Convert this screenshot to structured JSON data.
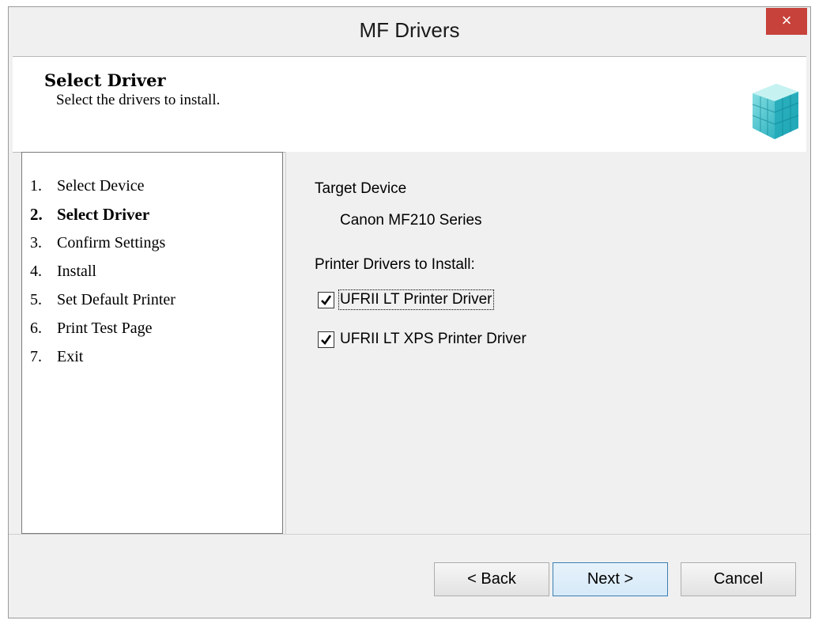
{
  "window": {
    "title": "MF Drivers",
    "close_label": "×"
  },
  "header": {
    "title": "Select Driver",
    "subtitle": "Select the drivers to install.",
    "icon": "cube-blocks-icon"
  },
  "steps": [
    {
      "num": "1.",
      "label": "Select Device"
    },
    {
      "num": "2.",
      "label": "Select Driver",
      "active": true
    },
    {
      "num": "3.",
      "label": "Confirm Settings"
    },
    {
      "num": "4.",
      "label": "Install"
    },
    {
      "num": "5.",
      "label": "Set Default Printer"
    },
    {
      "num": "6.",
      "label": "Print Test Page"
    },
    {
      "num": "7.",
      "label": "Exit"
    }
  ],
  "content": {
    "target_label": "Target Device",
    "target_value": "Canon MF210 Series",
    "drivers_label": "Printer Drivers to Install:",
    "drivers": [
      {
        "label": "UFRII LT Printer Driver",
        "checked": true
      },
      {
        "label": "UFRII LT XPS Printer Driver",
        "checked": true
      }
    ]
  },
  "buttons": {
    "back": "< Back",
    "next": "Next >",
    "cancel": "Cancel"
  }
}
